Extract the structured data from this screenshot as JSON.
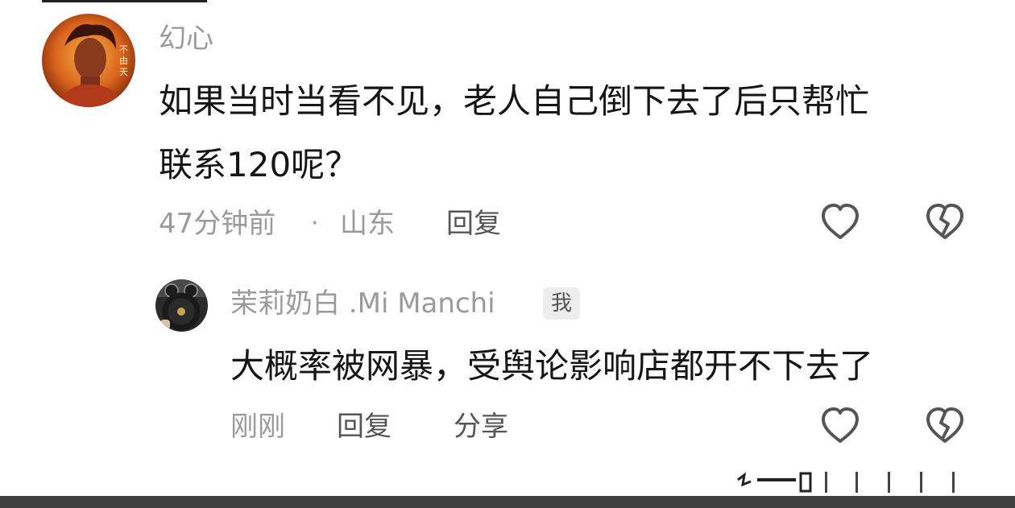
{
  "comment": {
    "username": "幻心",
    "avatar_icon": "avatar-icon",
    "text_line1": "如果当时当看不见，老人自己倒下去了后只帮忙",
    "text_line2": "联系120呢？",
    "time": "47分钟前",
    "separator": "·",
    "location": "山东",
    "reply_label": "回复",
    "like_icon": "heart-icon",
    "dislike_icon": "broken-heart-icon"
  },
  "reply": {
    "username": "茉莉奶白 .Mi Manchi",
    "badge": "我",
    "avatar_icon": "avatar-icon",
    "text": "大概率被网暴，受舆论影响店都开不下去了",
    "time": "刚刚",
    "reply_label": "回复",
    "share_label": "分享",
    "like_icon": "heart-icon",
    "dislike_icon": "broken-heart-icon"
  },
  "colors": {
    "meta_gray": "#9a9a9a",
    "text_dark": "#161616",
    "bottom_bar": "#3f3f3f"
  }
}
